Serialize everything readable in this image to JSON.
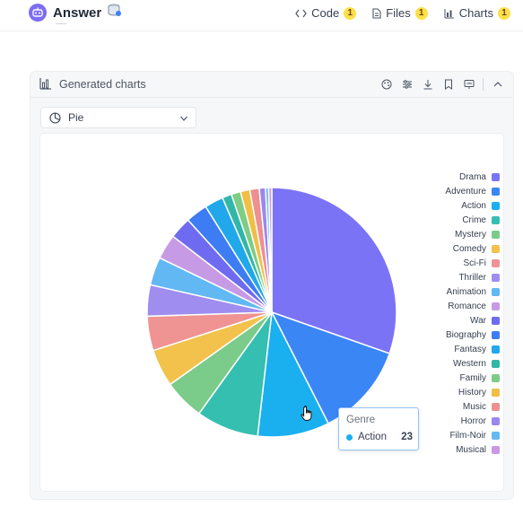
{
  "header": {
    "title": "Answer",
    "tabs": [
      {
        "label": "Code",
        "count": "1",
        "icon": "code-icon"
      },
      {
        "label": "Files",
        "count": "1",
        "icon": "file-icon"
      },
      {
        "label": "Charts",
        "count": "1",
        "icon": "bar-chart-icon"
      }
    ]
  },
  "panel": {
    "title": "Generated charts",
    "actions": [
      "palette-icon",
      "sliders-icon",
      "download-icon",
      "bookmark-icon",
      "present-icon",
      "collapse-icon"
    ]
  },
  "chart_selector": {
    "selected": "Pie",
    "icon": "pie-icon"
  },
  "tooltip": {
    "title": "Genre",
    "series": "Action",
    "value": "23",
    "color": "#1ab0f0"
  },
  "chart_data": {
    "type": "pie",
    "categories": [
      "Drama",
      "Adventure",
      "Action",
      "Crime",
      "Mystery",
      "Comedy",
      "Sci-Fi",
      "Thriller",
      "Animation",
      "Romance",
      "War",
      "Biography",
      "Fantasy",
      "Western",
      "Family",
      "History",
      "Music",
      "Horror",
      "Film-Noir",
      "Musical"
    ],
    "values": [
      75,
      30,
      23,
      20,
      13,
      12,
      11,
      10,
      9,
      8,
      7,
      7,
      6,
      3,
      3,
      3,
      3,
      2,
      1,
      1
    ],
    "colors": [
      "#7b73f6",
      "#3b86f5",
      "#1ab0f0",
      "#35bfb1",
      "#7bcb8a",
      "#f2c24c",
      "#ef9393",
      "#9f8df0",
      "#62b8f2",
      "#c79ae6",
      "#6f6bf0",
      "#3d7cf2",
      "#20a8ea",
      "#31b6a7",
      "#7ccd85",
      "#f1be46",
      "#ee9090",
      "#9b88ee",
      "#66baf1",
      "#cc98e4"
    ],
    "legend_position": "right"
  }
}
